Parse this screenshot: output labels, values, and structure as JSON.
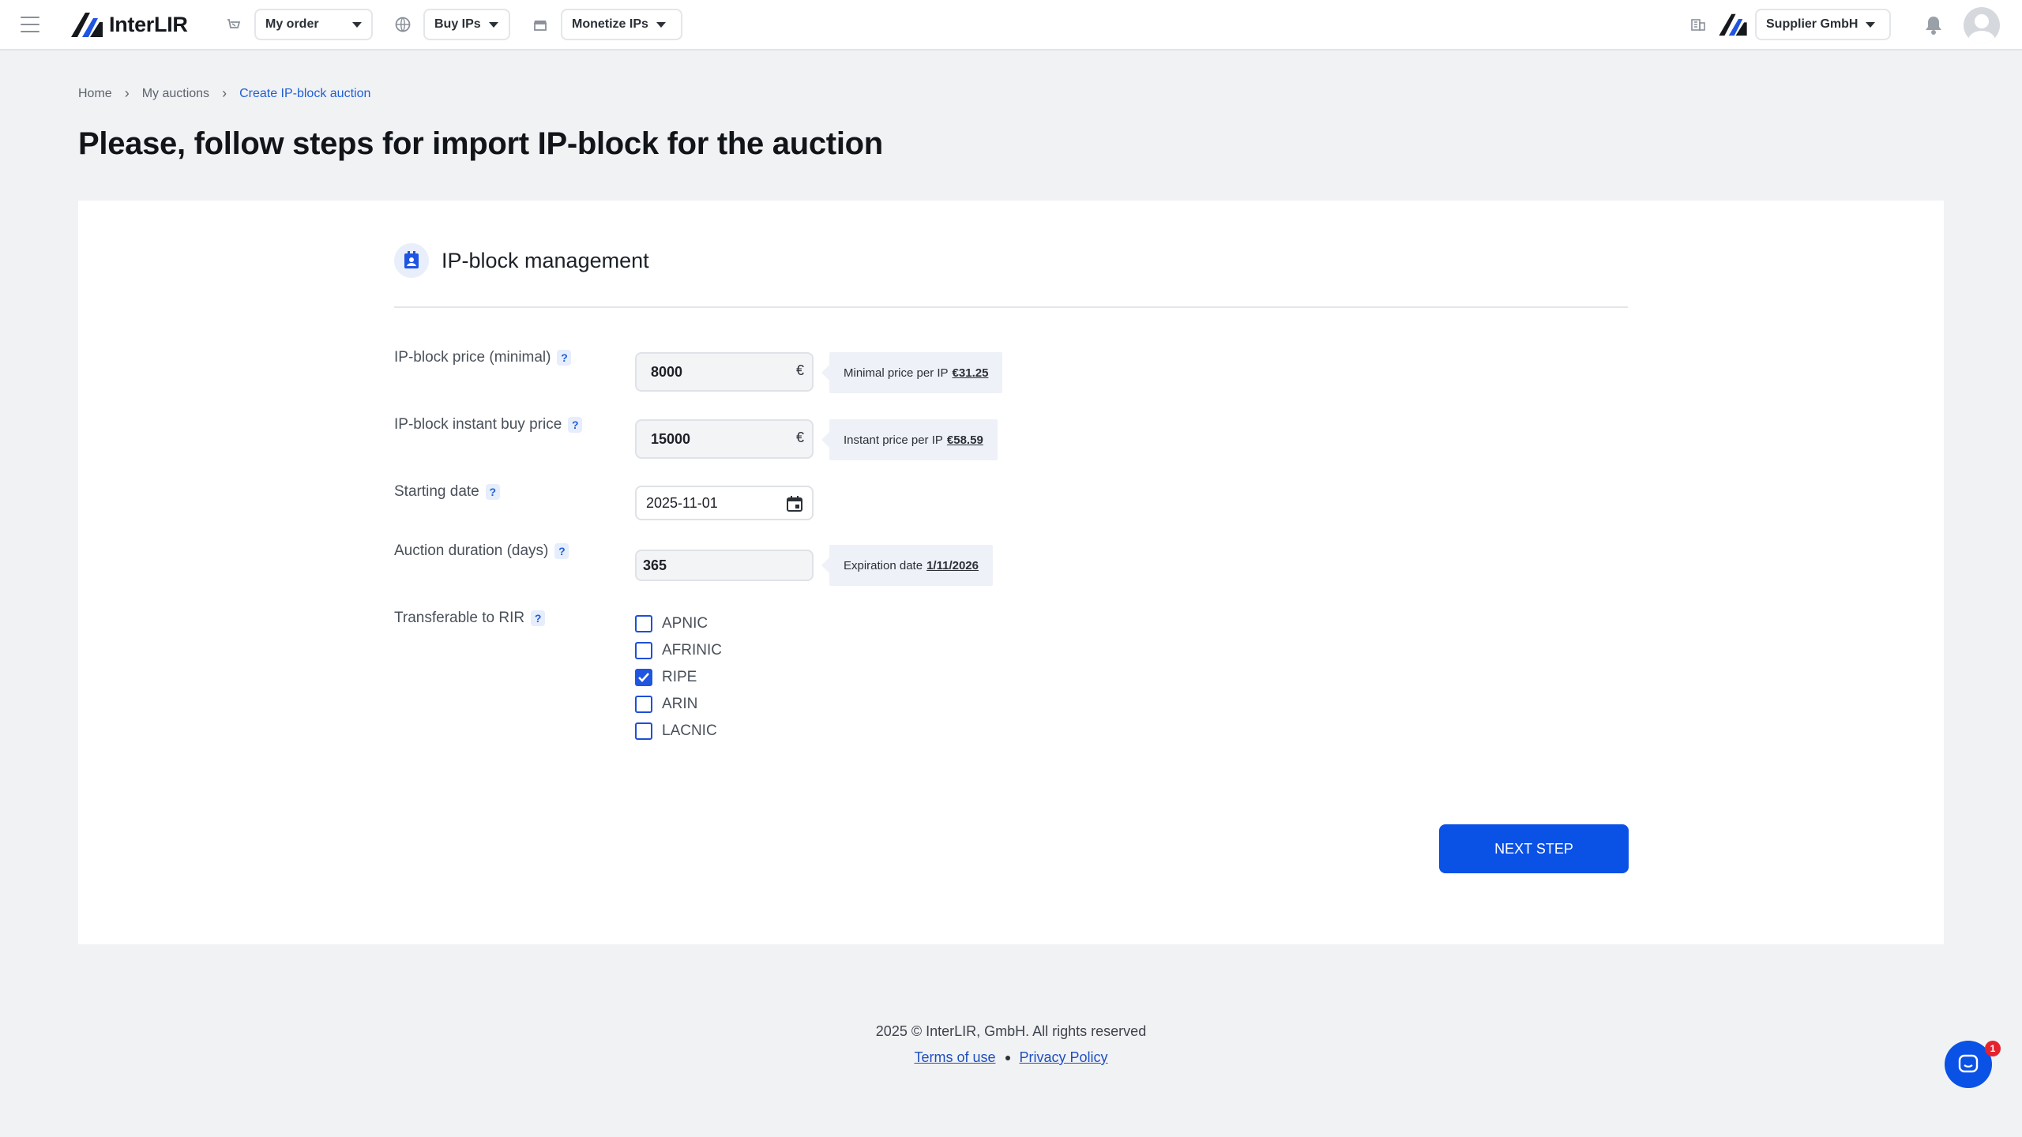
{
  "header": {
    "brand": "InterLIR",
    "nav": [
      {
        "icon": "cart-icon",
        "label": "My order"
      },
      {
        "icon": "globe-icon",
        "label": "Buy IPs"
      },
      {
        "icon": "store-icon",
        "label": "Monetize IPs"
      }
    ],
    "company": {
      "icon": "building-icon",
      "label": "Supplier GmbH"
    },
    "notifications_icon": "bell-icon",
    "avatar_icon": "user-avatar-icon"
  },
  "breadcrumb": {
    "items": [
      "Home",
      "My auctions",
      "Create IP-block auction"
    ]
  },
  "page_title": "Please, follow steps for import IP-block for the auction",
  "card": {
    "title": "IP-block management",
    "title_icon": "contact-card-icon",
    "fields": {
      "min_price": {
        "label": "IP-block price (minimal)",
        "value": "8000",
        "currency": "€",
        "hint_text": "Minimal price per IP",
        "hint_value": "€31.25"
      },
      "instant_price": {
        "label": "IP-block instant buy price",
        "value": "15000",
        "currency": "€",
        "hint_text": "Instant price per IP",
        "hint_value": "€58.59"
      },
      "start_date": {
        "label": "Starting date",
        "value": "2025-11-01"
      },
      "duration": {
        "label": "Auction duration (days)",
        "value": "365",
        "hint_text": "Expiration date",
        "hint_value": "1/11/2026"
      },
      "rir": {
        "label": "Transferable to RIR",
        "options": [
          {
            "label": "APNIC",
            "checked": false
          },
          {
            "label": "AFRINIC",
            "checked": false
          },
          {
            "label": "RIPE",
            "checked": true
          },
          {
            "label": "ARIN",
            "checked": false
          },
          {
            "label": "LACNIC",
            "checked": false
          }
        ]
      }
    },
    "help_mark": "?",
    "next_button": "NEXT STEP"
  },
  "footer": {
    "copyright": "2025 © InterLIR, GmbH. All rights reserved",
    "terms": "Terms of use",
    "privacy": "Privacy Policy"
  },
  "chat": {
    "icon": "chat-icon",
    "badge": "1"
  },
  "colors": {
    "accent": "#0a51e6",
    "link": "#1f5fd6",
    "badge": "#e5232d"
  }
}
